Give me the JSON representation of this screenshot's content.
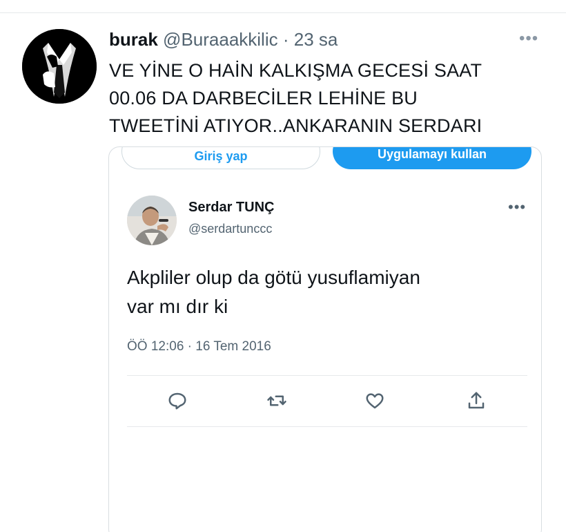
{
  "tweet": {
    "author_name": "burak",
    "author_handle": "@Buraaakkilic",
    "separator": "·",
    "time": "23 sa",
    "more_icon": "more-horizontal-icon",
    "text_lines": [
      "VE YİNE O HAİN KALKIŞMA GECESİ SAAT",
      "00.06 DA DARBECİLER LEHİNE BU",
      "TWEETİNİ ATIYOR..ANKARANIN SERDARI"
    ]
  },
  "embedded": {
    "login_label": "Giriş yap",
    "app_label": "Uygulamayı kullan",
    "author_name": "Serdar TUNÇ",
    "author_handle": "@serdartunccc",
    "more_icon": "more-horizontal-icon",
    "text_lines": [
      "Akpliler olup da götü yusuflamiyan",
      "var mı dır ki"
    ],
    "timestamp": "ÖÖ 12:06 · 16 Tem 2016",
    "actions": [
      "reply-icon",
      "retweet-icon",
      "like-icon",
      "share-icon"
    ]
  },
  "colors": {
    "accent": "#1d9bf0",
    "text": "#0f1419",
    "secondary": "#536471",
    "border": "#d8dde1"
  }
}
